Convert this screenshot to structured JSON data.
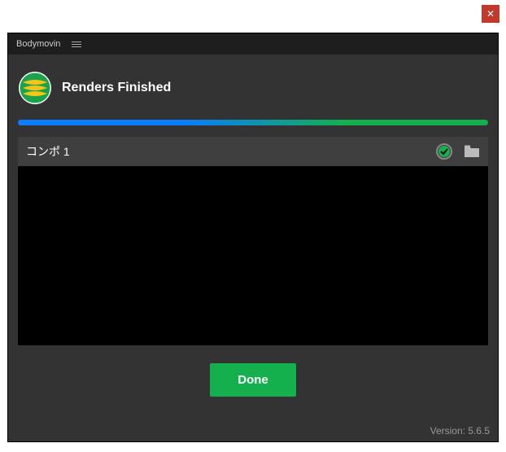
{
  "window": {
    "close_glyph": "✕"
  },
  "titlebar": {
    "title": "Bodymovin"
  },
  "header": {
    "status_text": "Renders Finished"
  },
  "render": {
    "item_name": "コンポ 1"
  },
  "buttons": {
    "done_label": "Done"
  },
  "footer": {
    "version_label": "Version: 5.6.5"
  }
}
